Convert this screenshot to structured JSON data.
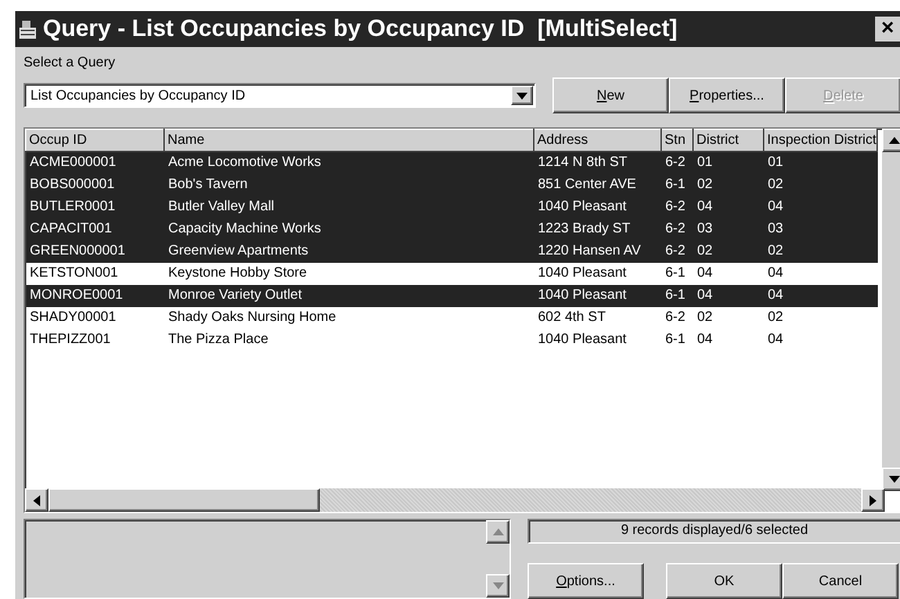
{
  "window": {
    "title": "Query - List Occupancies by Occupancy ID  [MultiSelect]",
    "close": "×"
  },
  "query": {
    "label": "Select a Query",
    "value": "List Occupancies by Occupancy ID"
  },
  "query_buttons": [
    {
      "accel": "N",
      "rest": "ew",
      "disabled": false
    },
    {
      "accel": "P",
      "rest": "roperties...",
      "disabled": false
    },
    {
      "accel": "D",
      "rest": "elete",
      "disabled": true
    }
  ],
  "table": {
    "columns": [
      "Occup ID",
      "Name",
      "Address",
      "Stn",
      "District",
      "Inspection District"
    ],
    "rows": [
      {
        "cells": [
          "ACME000001",
          "Acme Locomotive Works",
          "1214 N 8th ST",
          "6-2",
          "01",
          "01"
        ],
        "selected": true
      },
      {
        "cells": [
          "BOBS000001",
          "Bob's Tavern",
          "851 Center AVE",
          "6-1",
          "02",
          "02"
        ],
        "selected": true
      },
      {
        "cells": [
          "BUTLER0001",
          "Butler Valley Mall",
          "1040 Pleasant",
          "6-2",
          "04",
          "04"
        ],
        "selected": true
      },
      {
        "cells": [
          "CAPACIT001",
          "Capacity Machine Works",
          "1223 Brady ST",
          "6-2",
          "03",
          "03"
        ],
        "selected": true
      },
      {
        "cells": [
          "GREEN000001",
          "Greenview Apartments",
          "1220 Hansen AV",
          "6-2",
          "02",
          "02"
        ],
        "selected": true
      },
      {
        "cells": [
          "KETSTON001",
          "Keystone Hobby Store",
          "1040 Pleasant",
          "6-1",
          "04",
          "04"
        ],
        "selected": false
      },
      {
        "cells": [
          "MONROE0001",
          "Monroe Variety Outlet",
          "1040 Pleasant",
          "6-1",
          "04",
          "04"
        ],
        "selected": true
      },
      {
        "cells": [
          "SHADY00001",
          "Shady Oaks Nursing Home",
          "602 4th ST",
          "6-2",
          "02",
          "02"
        ],
        "selected": false
      },
      {
        "cells": [
          "THEPIZZ001",
          "The Pizza Place",
          "1040 Pleasant",
          "6-1",
          "04",
          "04"
        ],
        "selected": false
      }
    ]
  },
  "status": "9 records displayed/6 selected",
  "bottom_buttons": [
    {
      "accel": "O",
      "rest": "ptions..."
    },
    {
      "rest": "OK"
    },
    {
      "rest": "Cancel"
    }
  ]
}
